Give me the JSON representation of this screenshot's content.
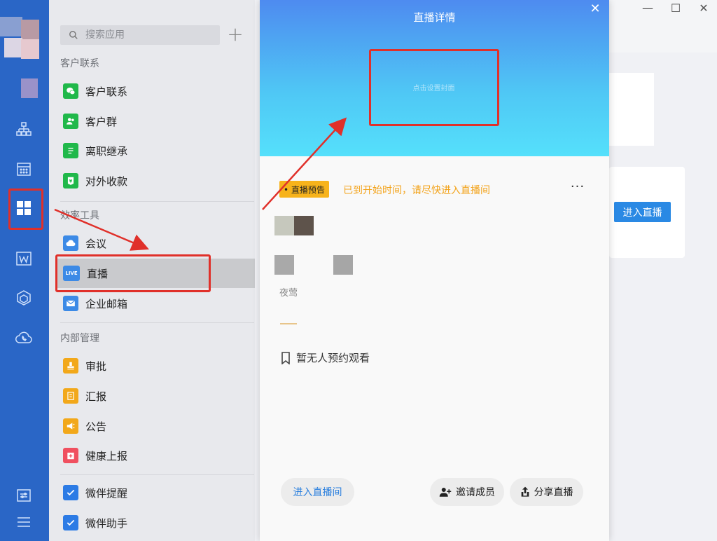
{
  "search": {
    "placeholder": "搜索应用"
  },
  "sections": {
    "customer": "客户联系",
    "efficiency": "效率工具",
    "internal": "内部管理"
  },
  "apps": [
    {
      "label": "客户联系",
      "color": "#20b84a"
    },
    {
      "label": "客户群",
      "color": "#20b84a"
    },
    {
      "label": "离职继承",
      "color": "#20b84a"
    },
    {
      "label": "对外收款",
      "color": "#20b84a"
    },
    {
      "label": "会议",
      "color": "#3c8ae6"
    },
    {
      "label": "直播",
      "color": "#3c8ae6",
      "icon_text": "LIVE"
    },
    {
      "label": "企业邮箱",
      "color": "#3c8ae6"
    },
    {
      "label": "审批",
      "color": "#f2a81a"
    },
    {
      "label": "汇报",
      "color": "#f2a81a"
    },
    {
      "label": "公告",
      "color": "#f2a81a"
    },
    {
      "label": "健康上报",
      "color": "#f05060"
    },
    {
      "label": "微伴提醒",
      "color": "#2c7be5"
    },
    {
      "label": "微伴助手",
      "color": "#2c7be5"
    }
  ],
  "detail": {
    "title": "直播详情",
    "cover_text": "点击设置封面",
    "tag": "• 直播预告",
    "status_message": "已到开始时间，请尽快进入直播间",
    "host": "夜莺",
    "reserve_text": "暂无人预约观看",
    "enter_room": "进入直播间",
    "invite": "邀请成员",
    "share": "分享直播"
  },
  "background_window": {
    "enter_live": "进入直播"
  },
  "colors": {
    "rail": "#2a66c6",
    "accent_orange": "#f7b31b",
    "annotation_red": "#e0302a"
  }
}
